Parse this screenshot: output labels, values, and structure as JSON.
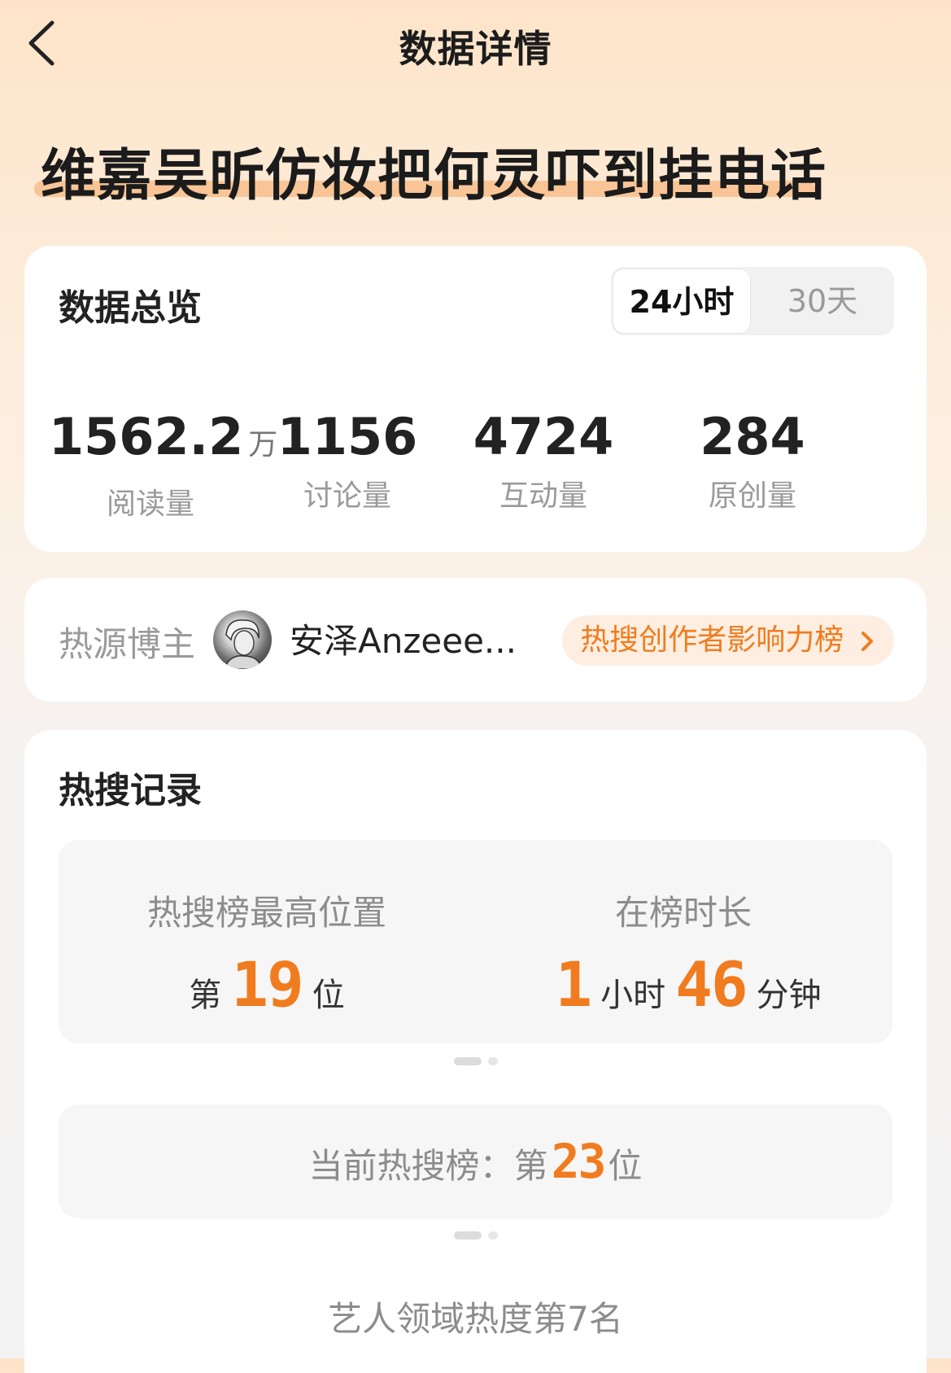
{
  "nav": {
    "title": "数据详情"
  },
  "topic": {
    "title": "维嘉吴昕仿妆把何灵吓到挂电话"
  },
  "overview": {
    "title": "数据总览",
    "tabs": [
      "24小时",
      "30天"
    ],
    "active_tab": "24小时",
    "stats": [
      {
        "value": "1562.2",
        "unit": "万",
        "label": "阅读量"
      },
      {
        "value": "1156",
        "unit": "",
        "label": "讨论量"
      },
      {
        "value": "4724",
        "unit": "",
        "label": "互动量"
      },
      {
        "value": "284",
        "unit": "",
        "label": "原创量"
      }
    ]
  },
  "source": {
    "label": "热源博主",
    "author_name": "安泽Anzeee...",
    "influence_link": "热搜创作者影响力榜"
  },
  "record": {
    "title": "热搜记录",
    "peak": {
      "label": "热搜榜最高位置",
      "prefix": "第",
      "rank": "19",
      "suffix": "位"
    },
    "duration": {
      "label": "在榜时长",
      "hours": "1",
      "hours_unit": "小时",
      "minutes": "46",
      "minutes_unit": "分钟"
    },
    "current": {
      "label": "当前热搜榜：",
      "prefix": "第",
      "rank": "23",
      "suffix": "位"
    },
    "domain_rank": "艺人领域热度第7名"
  },
  "colors": {
    "accent": "#f07c1f",
    "highlight": "#f9c596",
    "pill_bg": "#fdeee1"
  }
}
